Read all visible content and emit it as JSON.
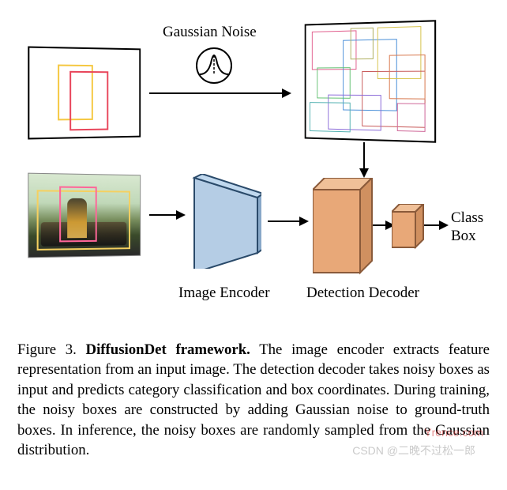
{
  "diagram": {
    "noise_label": "Gaussian Noise",
    "encoder_label": "Image Encoder",
    "decoder_label": "Detection Decoder",
    "output_label_line1": "Class",
    "output_label_line2": "Box"
  },
  "caption": {
    "prefix": "Figure 3. ",
    "title": "DiffusionDet framework.",
    "body": " The image encoder extracts feature representation from an input image. The detection decoder takes noisy boxes as input and predicts category classification and box coordinates. During training, the noisy boxes are constructed by adding Gaussian noise to ground-truth boxes. In inference, the noisy boxes are randomly sampled from the Gaussian distribution."
  },
  "watermark": {
    "w1": "Yrence.com",
    "w2": "CSDN @二晚不过松一郎"
  }
}
